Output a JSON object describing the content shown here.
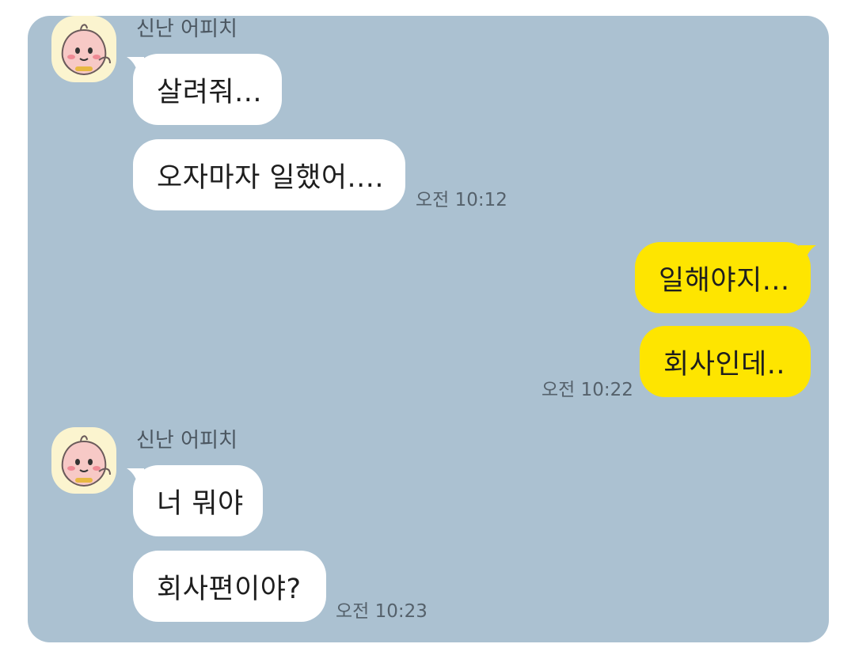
{
  "messages": [
    {
      "type": "received",
      "sender": "신난 어피치",
      "bubbles": [
        "살려줘...",
        "오자마자 일했어...."
      ],
      "time": "오전 10:12"
    },
    {
      "type": "sent",
      "bubbles": [
        "일해야지...",
        "회사인데.."
      ],
      "time": "오전 10:22"
    },
    {
      "type": "received",
      "sender": "신난 어피치",
      "bubbles": [
        "너 뭐야",
        "회사편이야?"
      ],
      "time": "오전 10:23"
    }
  ],
  "colors": {
    "chat_bg": "#abc1d1",
    "received_bubble": "#ffffff",
    "sent_bubble": "#fee500",
    "avatar_bg": "#fbf4cf"
  },
  "icons": {
    "avatar": "apeach-avatar-icon"
  }
}
